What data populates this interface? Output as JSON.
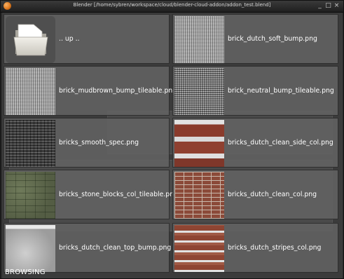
{
  "window": {
    "title": "Blender [/home/sybren/workspace/cloud/blender-cloud-addon/addon_test.blend]",
    "controls": {
      "minimize": "_",
      "maximize": "□",
      "close": "×"
    }
  },
  "browser": {
    "tiles": [
      {
        "label": ".. up ..",
        "thumb": "folder-icon"
      },
      {
        "label": "brick_dutch_soft_bump.png",
        "thumb": "bump-light"
      },
      {
        "label": "brick_mudbrown_bump_tileable.png",
        "thumb": "bump-light"
      },
      {
        "label": "brick_neutral_bump_tileable.png",
        "thumb": "bump-mid"
      },
      {
        "label": "bricks_smooth_spec.png",
        "thumb": "spec-dark"
      },
      {
        "label": "bricks_dutch_clean_side_col.png",
        "thumb": "side-col"
      },
      {
        "label": "bricks_stone_blocks_col_tileable.png",
        "thumb": "stone"
      },
      {
        "label": "bricks_dutch_clean_col.png",
        "thumb": "red-brick"
      },
      {
        "label": "bricks_dutch_clean_top_bump.png",
        "thumb": "top-bump"
      },
      {
        "label": "bricks_dutch_stripes_col.png",
        "thumb": "stripes"
      }
    ]
  },
  "status": {
    "text": "BROWSING"
  }
}
